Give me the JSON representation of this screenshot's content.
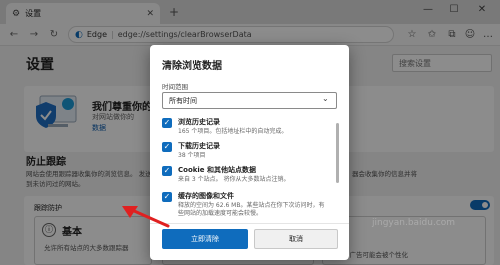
{
  "browser": {
    "tab_title": "设置",
    "tab_close": "✕",
    "new_tab": "+",
    "address_brand": "Edge",
    "address_url": "edge://settings/clearBrowserData"
  },
  "page": {
    "settings_title": "设置",
    "search_placeholder": "搜索设置",
    "hero_title": "我们尊重你的",
    "hero_sub": "对网站做你的",
    "hero_link": "数据",
    "section_title": "防止跟踪",
    "section_desc": "网站会使用跟踪器收集你的浏览信息。 发送到未访问过的网站。",
    "right_desc": "器会收集你的信息并将",
    "track_label": "跟踪防护",
    "basic_label": "基本",
    "basic_bullets": [
      "允许所有站点的大多数跟踪器",
      "内容和广告可能会被个性化"
    ]
  },
  "dialog": {
    "title": "清除浏览数据",
    "time_label": "时间范围",
    "time_value": "所有时间",
    "items": [
      {
        "title": "浏览历史记录",
        "desc": "165 个项目。包括地址栏中的自动完成。",
        "checked": true
      },
      {
        "title": "下载历史记录",
        "desc": "38 个项目",
        "checked": true
      },
      {
        "title": "Cookie 和其他站点数据",
        "desc": "来自 3 个站点。 将你从大多数站点注销。",
        "checked": true
      },
      {
        "title": "缓存的图像和文件",
        "desc": "释放的空间为 62.6 MB。某些站点在你下次访问时，有些网站的加载速度可能会较慢。",
        "checked": true
      }
    ],
    "confirm_label": "立即清除",
    "cancel_label": "取消"
  },
  "watermark": "jingyan.baidu.com",
  "colors": {
    "accent": "#0f6cbd",
    "arrow": "#e02020"
  }
}
